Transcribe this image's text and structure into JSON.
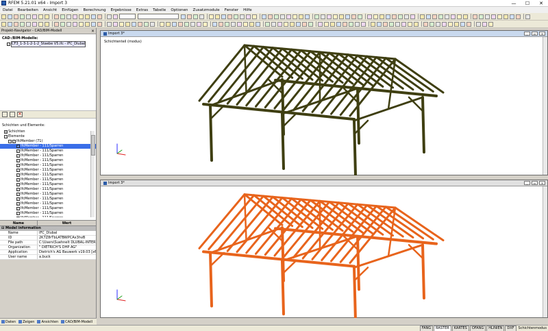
{
  "window": {
    "title": "RFEM 5.21.01 x64 - Import 3",
    "controls": [
      "—",
      "☐",
      "✕"
    ]
  },
  "menu": [
    "Datei",
    "Bearbeiten",
    "Ansicht",
    "Einfügen",
    "Berechnung",
    "Ergebnisse",
    "Extras",
    "Tabelle",
    "Optionen",
    "Zusatzmodule",
    "Fenster",
    "Hilfe"
  ],
  "navigator": {
    "title": "Projekt-Navigator - CAD/BIM-Modell",
    "models_label": "CAD-/BIM-Modelle:",
    "model_item": "CF3_1-3-1-2-1-2_Staebe V5.ifc - IFC_Dlubal",
    "layers_label": "Schichten und Elemente:",
    "tree": {
      "layers": "Schichten",
      "elements": "Elemente",
      "ifcmember": "IfcMember (71)",
      "item_label": "IfcMember - 111/Sparren",
      "item_count": 18
    }
  },
  "properties": {
    "col_name": "Name",
    "col_value": "Wert",
    "section": "Model information",
    "rows": [
      {
        "k": "Name",
        "v": "IFC_Dlubal"
      },
      {
        "k": "ID",
        "v": "2K7Z8rTbLATBWPCAx3hvB"
      },
      {
        "k": "File path",
        "v": "C:\\Users\\Suehnelt DLUBAL-INTERN\\D"
      },
      {
        "k": "Organization",
        "v": "\" DIETRICH'S DHP AG\""
      },
      {
        "k": "Application",
        "v": "Dietrich's AG Bauwerk v19.03 [x64]"
      },
      {
        "k": "User name",
        "v": "a.buck"
      }
    ]
  },
  "left_tabs": [
    "Daten",
    "Zeigen",
    "Ansichten",
    "CAD/BIM-Modell"
  ],
  "viewports": [
    {
      "title": "Import 3*",
      "label": "Schichtenteil (modus)"
    },
    {
      "title": "Import 3*",
      "label": ""
    }
  ],
  "statusbar": [
    "FANG",
    "RASTER",
    "KARTES",
    "OFANG",
    "HLINIEN",
    "DXF",
    "Schichtenmodus"
  ],
  "colors": {
    "model_top": "#3f3f12",
    "model_bottom": "#e8641c",
    "selected": "#3a6ee8"
  }
}
